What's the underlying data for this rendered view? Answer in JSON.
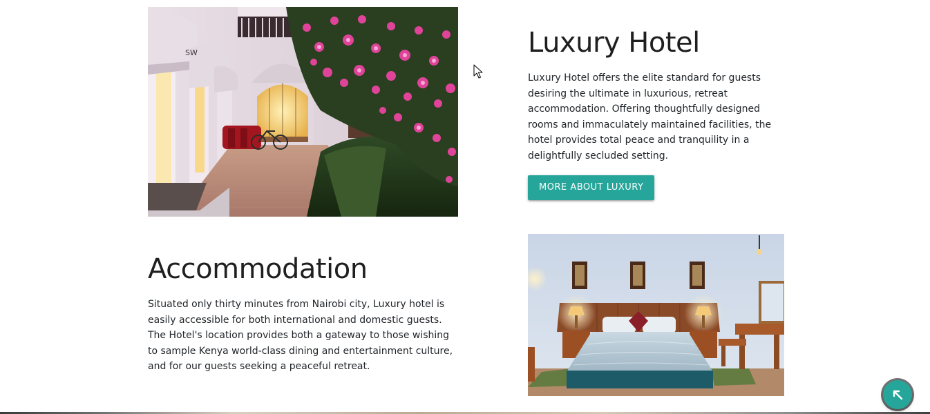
{
  "hotel_section": {
    "title": "Luxury Hotel",
    "description": "Luxury Hotel offers the elite standard for guests desiring the ultimate in luxurious, retreat accommodation. Offering thoughtfully designed rooms and immaculately maintained facilities, the hotel provides total peace and tranquility in a delightfully secluded setting.",
    "button_label": "MORE ABOUT LUXURY",
    "image": "hotel-courtyard-photo",
    "awning_text": "SW"
  },
  "accommodation_section": {
    "title": "Accommodation",
    "description": "Situated only thirty minutes from Nairobi city, Luxury hotel is easily accessible for both international and domestic guests. The Hotel's location provides both a gateway to those wishing to sample Kenya world-class dining and entertainment culture, and for our guests seeking a peaceful retreat.",
    "image": "bedroom-photo"
  },
  "scroll_top_button": {
    "icon": "arrow-up-left-icon"
  },
  "colors": {
    "accent": "#26a69a",
    "text": "#212529"
  }
}
